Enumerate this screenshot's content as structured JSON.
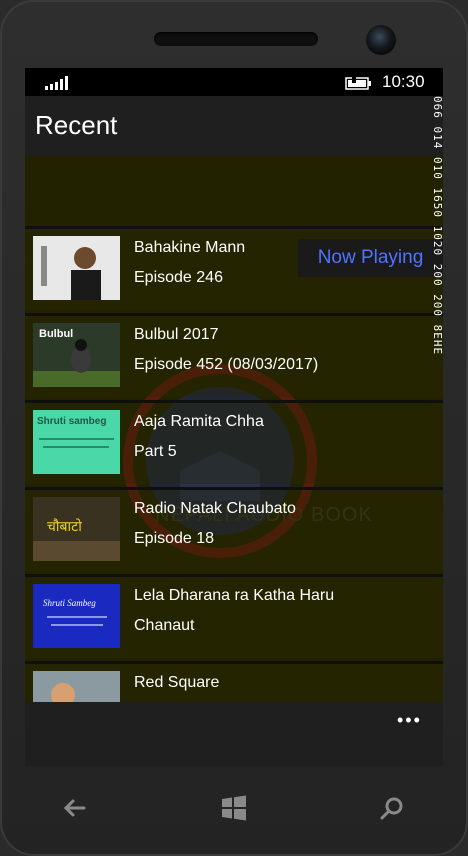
{
  "status": {
    "time": "10:30"
  },
  "header": {
    "title": "Recent"
  },
  "background": {
    "brand_text": "NEPALI AUDIO BOOK"
  },
  "now_playing": {
    "label": "Now Playing"
  },
  "items": [
    {
      "title": "Bahakine Mann",
      "subtitle": "Episode 246",
      "thumb_text": ""
    },
    {
      "title": "Bulbul 2017",
      "subtitle": "Episode 452 (08/03/2017)",
      "thumb_text": "Bulbul"
    },
    {
      "title": "Aaja Ramita Chha",
      "subtitle": "Part 5",
      "thumb_text": "Shruti sambeg"
    },
    {
      "title": "Radio Natak Chaubato",
      "subtitle": "Episode 18",
      "thumb_text": "चौबाटो"
    },
    {
      "title": "Lela Dharana ra Katha Haru",
      "subtitle": "Chanaut",
      "thumb_text": "Shruti Sambeg"
    },
    {
      "title": "Red Square",
      "subtitle": "",
      "thumb_text": ""
    }
  ],
  "appbar": {
    "more": "•••"
  },
  "debug": {
    "counter": "066 014 010 1650 1020 200 200 8EHE"
  },
  "colors": {
    "accent": "#4f74ff",
    "content_bg": "#232200"
  },
  "icons": [
    "signal-icon",
    "battery-icon",
    "back-icon",
    "windows-icon",
    "search-icon"
  ]
}
